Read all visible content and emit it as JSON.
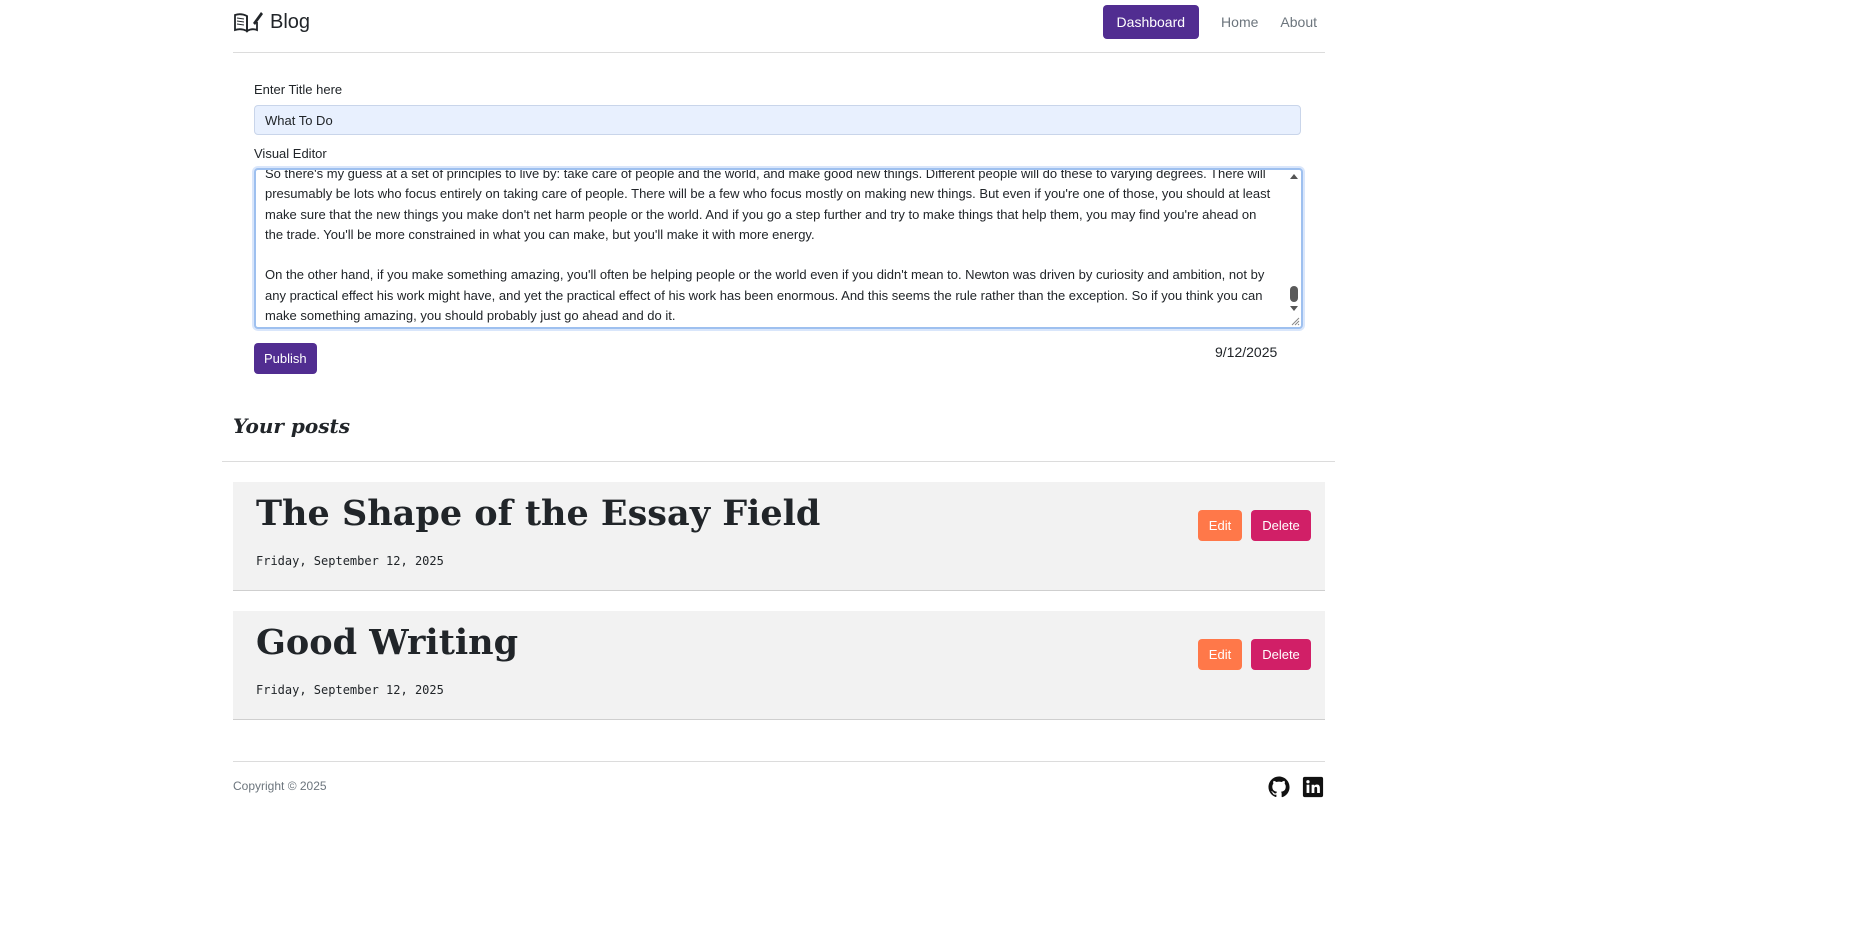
{
  "navbar": {
    "brand_icon": "book-pen-icon",
    "brand": "Blog",
    "links": [
      "Dashboard",
      "Home",
      "About"
    ]
  },
  "form": {
    "title_label": "Enter Title here",
    "title_value": "What To Do",
    "editor_label": "Visual Editor",
    "editor_text": "So there's my guess at a set of principles to live by: take care of people and the world, and make good new things. Different people will do these to varying degrees. There will presumably be lots who focus entirely on taking care of people. There will be a few who focus mostly on making new things. But even if you're one of those, you should at least make sure that the new things you make don't net harm people or the world. And if you go a step further and try to make things that help them, you may find you're ahead on the trade. You'll be more constrained in what you can make, but you'll make it with more energy.\n\nOn the other hand, if you make something amazing, you'll often be helping people or the world even if you didn't mean to. Newton was driven by curiosity and ambition, not by any practical effect his work might have, and yet the practical effect of his work has been enormous. And this seems the rule rather than the exception. So if you think you can make something amazing, you should probably just go ahead and do it.",
    "publish_label": "Publish",
    "date": "9/12/2025"
  },
  "posts_section": {
    "title": "Your posts",
    "posts": [
      {
        "title": "The Shape of the Essay Field",
        "date": "Friday, September 12, 2025",
        "edit": "Edit",
        "delete": "Delete"
      },
      {
        "title": "Good Writing",
        "date": "Friday, September 12, 2025",
        "edit": "Edit",
        "delete": "Delete"
      }
    ]
  },
  "footer": {
    "copyright": "Copyright © 2025",
    "icons": [
      "github-icon",
      "linkedin-icon"
    ]
  },
  "colors": {
    "primary": "#512d91",
    "edit": "#ff7849",
    "delete": "#d11f67"
  }
}
